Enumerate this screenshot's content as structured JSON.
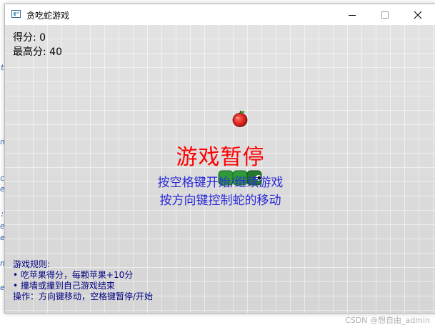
{
  "window": {
    "title": "贪吃蛇游戏",
    "controls": [
      "minimize",
      "maximize",
      "close"
    ]
  },
  "hud": {
    "score": "得分: 0",
    "high_score": "最高分: 40"
  },
  "overlay": {
    "title": "游戏暂停",
    "hint_line1": "按空格键开始/继续游戏",
    "hint_line2": "按方向键控制蛇的移动"
  },
  "rules": {
    "heading": "游戏规则:",
    "items": [
      "• 吃苹果得分，每颗苹果+10分",
      "• 撞墙或撞到自己游戏结束",
      "操作：方向键移动，空格键暂停/开始"
    ]
  },
  "game": {
    "apple_icon": "apple-icon",
    "snake_segments": 3,
    "snake_color": "#2e9a3a",
    "apple_color": "#e0201b"
  },
  "colors": {
    "pause_title": "#ff0000",
    "hint": "#2a2ad8",
    "rules": "#000080",
    "board": "#d9d9d9"
  },
  "watermark": "CSDN @想自由_admin"
}
